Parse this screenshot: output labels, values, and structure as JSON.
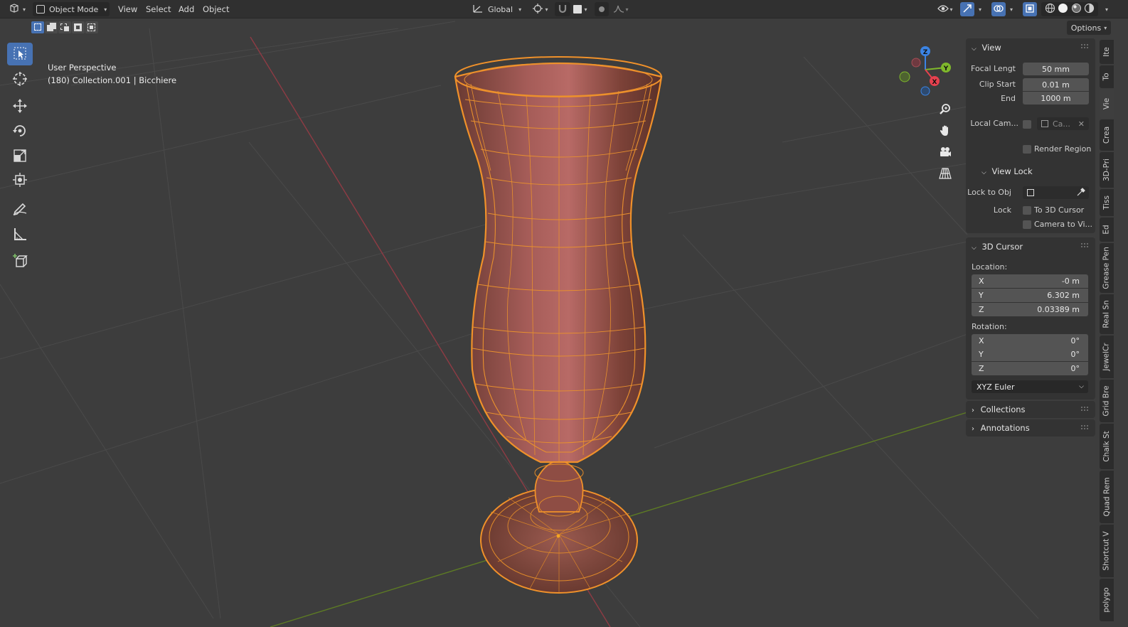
{
  "header": {
    "editor_type_icon": "3d-viewport-icon",
    "mode_label": "Object Mode",
    "menus": [
      "View",
      "Select",
      "Add",
      "Object"
    ],
    "transform_orientation": "Global",
    "options_label": "Options"
  },
  "viewport": {
    "perspective_label": "User Perspective",
    "object_info": "(180) Collection.001 | Bicchiere",
    "gizmo_axes": {
      "x": "X",
      "y": "Y",
      "z": "Z"
    }
  },
  "tools": [
    "select-box",
    "cursor",
    "move",
    "rotate",
    "scale",
    "transform",
    "annotate",
    "measure",
    "add-cube"
  ],
  "npanel": {
    "view": {
      "title": "View",
      "focal_label": "Focal Lengt",
      "focal_value": "50 mm",
      "clip_start_label": "Clip Start",
      "clip_start_value": "0.01 m",
      "clip_end_label": "End",
      "clip_end_value": "1000 m",
      "local_camera_label": "Local Cam...",
      "local_camera_value": "Ca...",
      "render_region_label": "Render Region"
    },
    "view_lock": {
      "title": "View Lock",
      "lock_to_obj_label": "Lock to Obj",
      "lock_label": "Lock",
      "to_3d_cursor_label": "To 3D Cursor",
      "camera_to_view_label": "Camera to Vi..."
    },
    "cursor": {
      "title": "3D Cursor",
      "location_label": "Location:",
      "location": [
        {
          "axis": "X",
          "value": "-0 m"
        },
        {
          "axis": "Y",
          "value": "6.302 m"
        },
        {
          "axis": "Z",
          "value": "0.03389 m"
        }
      ],
      "rotation_label": "Rotation:",
      "rotation": [
        {
          "axis": "X",
          "value": "0°"
        },
        {
          "axis": "Y",
          "value": "0°"
        },
        {
          "axis": "Z",
          "value": "0°"
        }
      ],
      "rotation_mode": "XYZ Euler"
    },
    "collections_title": "Collections",
    "annotations_title": "Annotations"
  },
  "tabs": [
    "Ite",
    "To",
    "Vie",
    "Crea",
    "3D-Pri",
    "Tiss",
    "Ed",
    "Grease Pen",
    "Real Sn",
    "JewelCr",
    "Grid Bre",
    "Chalk St",
    "Quad Rem",
    "Shortcut V",
    "polygo"
  ],
  "colors": {
    "header_bg": "#303030",
    "viewport_bg": "#3d3d3d",
    "accent": "#4772b3",
    "selection_orange": "#f0912a",
    "axis_x": "#e6414e",
    "axis_y": "#7fb82b",
    "axis_z": "#3b84e4"
  }
}
